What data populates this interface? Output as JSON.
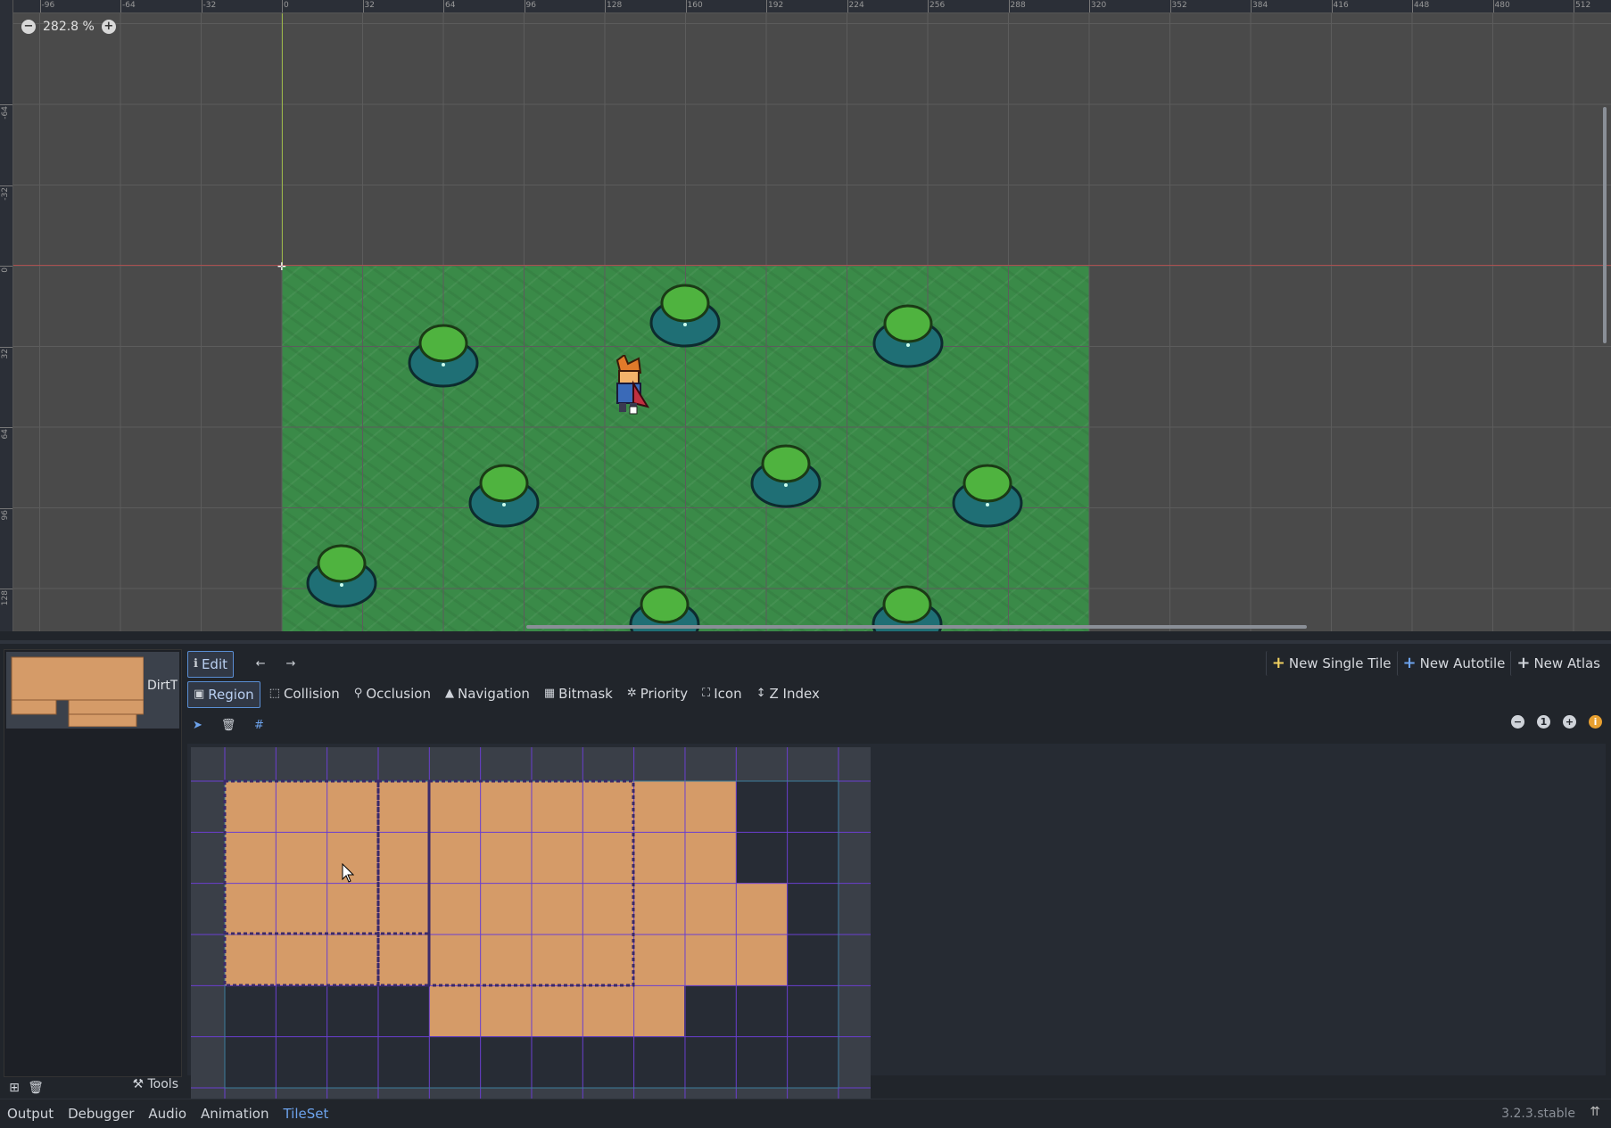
{
  "viewport": {
    "zoom_label": "282.8 %",
    "ruler_top_labels": [
      "-96",
      "-64",
      "-32",
      "0",
      "32",
      "64",
      "96",
      "128",
      "160",
      "192",
      "224",
      "256",
      "288",
      "320",
      "352",
      "384",
      "416",
      "448",
      "480",
      "512"
    ],
    "ruler_left_labels": [
      "-64",
      "-32",
      "0",
      "32",
      "64",
      "96",
      "128"
    ]
  },
  "tile_list": {
    "items": [
      {
        "name": "DirtTileset"
      }
    ],
    "tools_label": "Tools"
  },
  "toolbar": {
    "edit_label": "Edit",
    "new_single_tile": "New Single Tile",
    "new_autotile": "New Autotile",
    "new_atlas": "New Atlas"
  },
  "modes": {
    "region": "Region",
    "collision": "Collision",
    "occlusion": "Occlusion",
    "navigation": "Navigation",
    "bitmask": "Bitmask",
    "priority": "Priority",
    "icon": "Icon",
    "z_index": "Z Index"
  },
  "bottom_tabs": [
    "Output",
    "Debugger",
    "Audio",
    "Animation",
    "TileSet"
  ],
  "active_tab": "TileSet",
  "version": "3.2.3.stable",
  "colors": {
    "accent": "#6da3ec",
    "grass": "#3a8a48",
    "dirt": "#d59b68",
    "grid_purple": "#6a3fcf"
  }
}
